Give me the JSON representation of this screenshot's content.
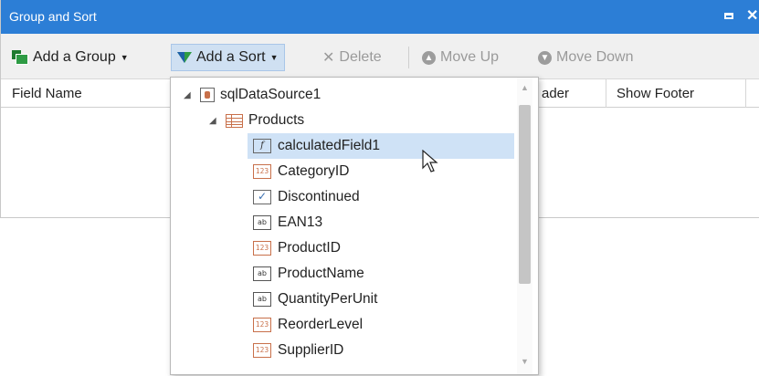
{
  "window": {
    "title": "Group and Sort"
  },
  "toolbar": {
    "add_group": "Add a Group",
    "add_sort": "Add a Sort",
    "delete": "Delete",
    "move_up": "Move Up",
    "move_down": "Move Down"
  },
  "grid": {
    "columns": [
      "Field Name",
      "ader",
      "Show Footer"
    ]
  },
  "tree": {
    "datasource": "sqlDataSource1",
    "table": "Products",
    "fields": [
      {
        "name": "calculatedField1",
        "type": "f",
        "icon": "calculated-field-icon",
        "selected": true
      },
      {
        "name": "CategoryID",
        "type": "123",
        "icon": "number-field-icon"
      },
      {
        "name": "Discontinued",
        "type": "✓",
        "icon": "boolean-field-icon"
      },
      {
        "name": "EAN13",
        "type": "ab",
        "icon": "string-field-icon"
      },
      {
        "name": "ProductID",
        "type": "123",
        "icon": "number-field-icon"
      },
      {
        "name": "ProductName",
        "type": "ab",
        "icon": "string-field-icon"
      },
      {
        "name": "QuantityPerUnit",
        "type": "ab",
        "icon": "string-field-icon"
      },
      {
        "name": "ReorderLevel",
        "type": "123",
        "icon": "number-field-icon"
      },
      {
        "name": "SupplierID",
        "type": "123",
        "icon": "number-field-icon"
      }
    ]
  },
  "colors": {
    "titlebar": "#2c7ed6",
    "selection": "#cfe2f6",
    "accent_orange": "#c8704a"
  }
}
